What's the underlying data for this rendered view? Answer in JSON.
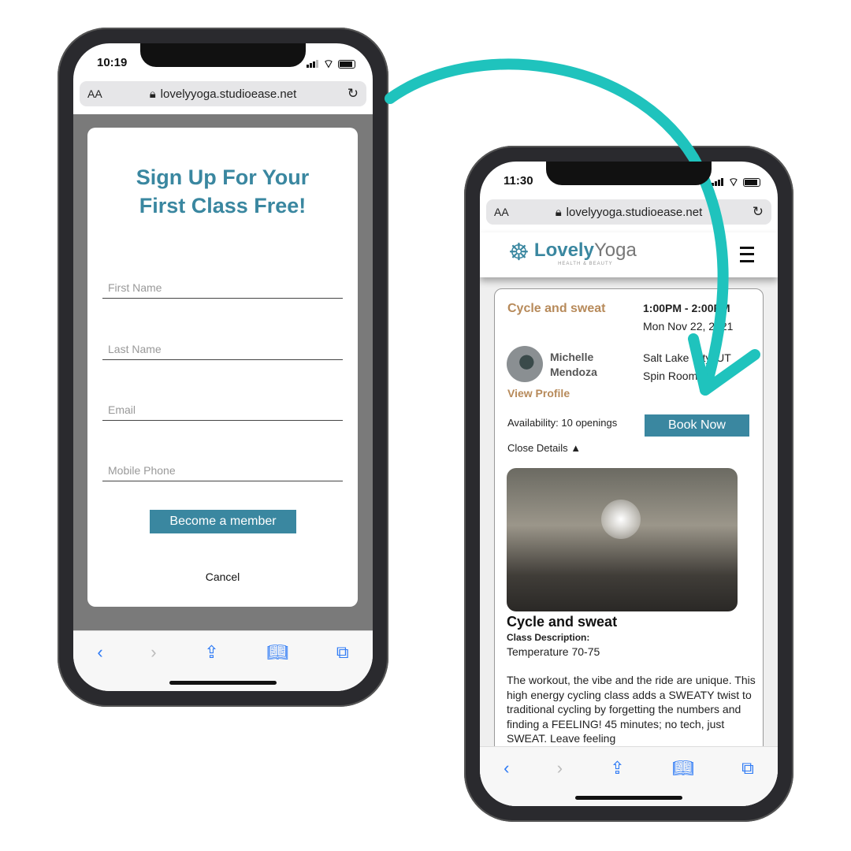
{
  "colors": {
    "accent": "#3a87a0",
    "gold": "#b78a5a",
    "arrow": "#1fc3bd"
  },
  "phone1": {
    "time": "10:19",
    "aa": "AA",
    "url": "lovelyyoga.studioease.net",
    "modal": {
      "title_line1": "Sign Up For Your",
      "title_line2": "First Class Free!",
      "fields": [
        {
          "placeholder": "First Name"
        },
        {
          "placeholder": "Last Name"
        },
        {
          "placeholder": "Email"
        },
        {
          "placeholder": "Mobile Phone"
        }
      ],
      "submit": "Become a member",
      "cancel": "Cancel"
    }
  },
  "phone2": {
    "time": "11:30",
    "aa": "AA",
    "url": "lovelyyoga.studioease.net",
    "logo": {
      "word1": "Lovely",
      "word2": "Yoga",
      "tag": "HEALTH & BEAUTY"
    },
    "card": {
      "class_name": "Cycle and sweat",
      "time": "1:00PM - 2:00PM",
      "date": "Mon Nov 22, 2021",
      "instructor_first": "Michelle",
      "instructor_last": "Mendoza",
      "view_profile": "View Profile",
      "location": "Salt Lake City, UT",
      "room": "Spin Room",
      "availability": "Availability: 10 openings",
      "book": "Book Now",
      "close_details": "Close Details ▲",
      "detail_title": "Cycle and sweat",
      "desc_label": "Class Description:",
      "temp": "Temperature 70-75",
      "description": "The workout, the vibe and the ride are unique. This high energy cycling class adds a SWEATY twist to traditional cycling by forgetting the numbers and finding a FEELING! 45 minutes; no tech, just SWEAT. Leave feeling"
    }
  },
  "icons": [
    "lock-icon",
    "reload-icon",
    "back-icon",
    "forward-icon",
    "share-icon",
    "bookmarks-icon",
    "tabs-icon",
    "hamburger-menu-icon"
  ]
}
